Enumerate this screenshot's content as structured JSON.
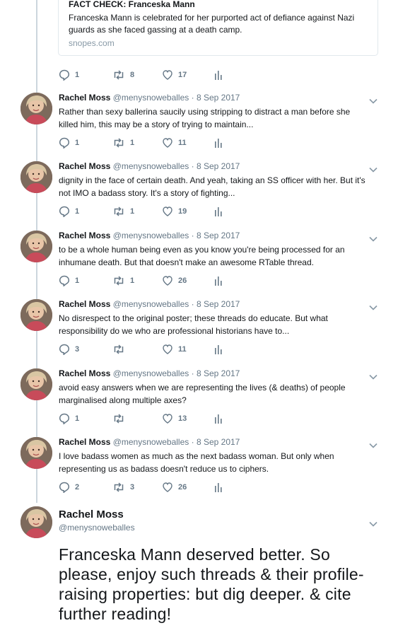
{
  "card": {
    "title": "FACT CHECK: Franceska Mann",
    "description": "Franceska Mann is celebrated for her purported act of defiance against Nazi guards as she faced gassing at a death camp.",
    "domain": "snopes.com"
  },
  "first_actions": {
    "replies": "1",
    "retweets": "8",
    "likes": "17"
  },
  "tweets": [
    {
      "name": "Rachel Moss",
      "handle": "@menysnoweballes",
      "dot": "·",
      "date": "8 Sep 2017",
      "text": "Rather than sexy ballerina saucily using stripping to distract a man before she killed him, this may be a story of trying to maintain...",
      "replies": "1",
      "retweets": "1",
      "likes": "11"
    },
    {
      "name": "Rachel Moss",
      "handle": "@menysnoweballes",
      "dot": "·",
      "date": "8 Sep 2017",
      "text": "dignity in the face of certain death. And yeah, taking an SS officer with her. But it's not IMO a badass story. It's a story of fighting...",
      "replies": "1",
      "retweets": "1",
      "likes": "19"
    },
    {
      "name": "Rachel Moss",
      "handle": "@menysnoweballes",
      "dot": "·",
      "date": "8 Sep 2017",
      "text": "to be a whole human being even as you know you're being processed for an inhumane death. But that doesn't make an awesome RTable thread.",
      "replies": "1",
      "retweets": "1",
      "likes": "26"
    },
    {
      "name": "Rachel Moss",
      "handle": "@menysnoweballes",
      "dot": "·",
      "date": "8 Sep 2017",
      "text": "No disrespect to the original poster; these threads do educate. But what responsibility do we who are professional historians have to...",
      "replies": "3",
      "retweets": "",
      "likes": "11"
    },
    {
      "name": "Rachel Moss",
      "handle": "@menysnoweballes",
      "dot": "·",
      "date": "8 Sep 2017",
      "text": "avoid easy answers when we are representing the lives (& deaths) of people marginalised along multiple axes?",
      "replies": "1",
      "retweets": "",
      "likes": "13"
    },
    {
      "name": "Rachel Moss",
      "handle": "@menysnoweballes",
      "dot": "·",
      "date": "8 Sep 2017",
      "text": "I love badass women as much as the next badass woman. But only when representing us as badass doesn't reduce us to ciphers.",
      "replies": "2",
      "retweets": "3",
      "likes": "26"
    }
  ],
  "main_tweet": {
    "name": "Rachel Moss",
    "handle": "@menysnoweballes",
    "text": "Franceska Mann deserved better. So please, enjoy such threads & their profile-raising properties: but dig deeper. & cite further reading!"
  },
  "icons": {
    "reply": "reply-icon",
    "retweet": "retweet-icon",
    "like": "heart-icon",
    "analytics": "analytics-icon",
    "caret": "chevron-down-icon"
  },
  "colors": {
    "icon": "#657786",
    "line": "#ccd6dd",
    "text": "#14171a",
    "secondary": "#657786"
  }
}
